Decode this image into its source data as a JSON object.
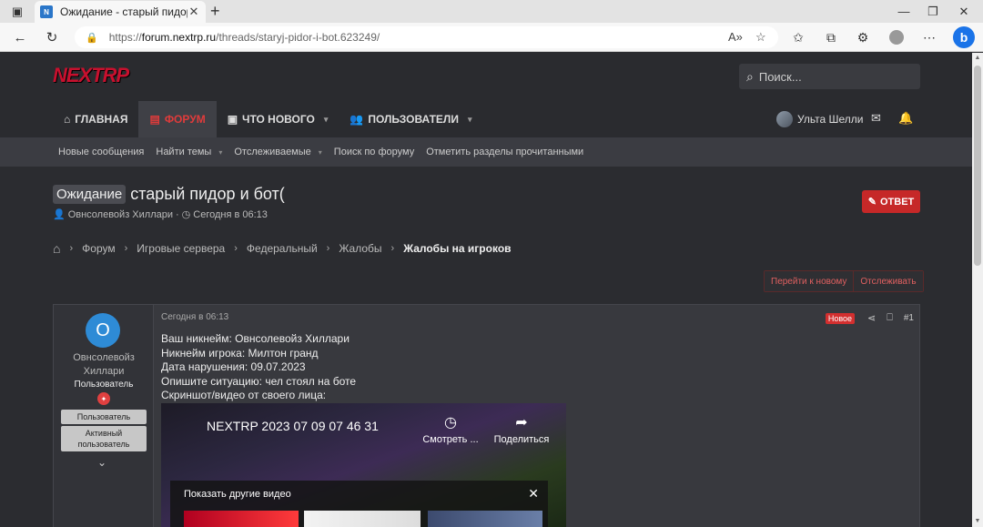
{
  "browser": {
    "tab_title": "Ожидание - старый пидор и бот(",
    "favicon_text": "N",
    "url_proto": "https://",
    "url_host": "forum.nextrp.ru",
    "url_path": "/threads/staryj-pidor-i-bot.623249/"
  },
  "header": {
    "logo": "NEXTRP",
    "search_placeholder": "Поиск...",
    "nav": [
      {
        "label": "Главная",
        "icon": "home-icon",
        "active": false,
        "caret": false
      },
      {
        "label": "Форум",
        "icon": "forum-icon",
        "active": true,
        "caret": false
      },
      {
        "label": "Что нового",
        "icon": "news-icon",
        "active": false,
        "caret": true
      },
      {
        "label": "Пользователи",
        "icon": "users-icon",
        "active": false,
        "caret": true
      }
    ],
    "username": "Ульта Шелли"
  },
  "subnav": [
    {
      "label": "Новые сообщения",
      "caret": false
    },
    {
      "label": "Найти темы",
      "caret": true
    },
    {
      "label": "Отслеживаемые",
      "caret": true
    },
    {
      "label": "Поиск по форуму",
      "caret": false
    },
    {
      "label": "Отметить разделы прочитанными",
      "caret": false
    }
  ],
  "thread": {
    "prefix": "Ожидание",
    "title": "старый пидор и бот(",
    "author": "Овнсолевойз Хиллари",
    "date": "Сегодня в 06:13",
    "reply_label": "ОТВЕТ"
  },
  "breadcrumbs": [
    "Форум",
    "Игровые сервера",
    "Федеральный",
    "Жалобы",
    "Жалобы на игроков"
  ],
  "tools": {
    "goto_new": "Перейти к новому",
    "watch": "Отслеживать"
  },
  "post": {
    "avatar_letter": "O",
    "username": "Овнсолевойз Хиллари",
    "role": "Пользователь",
    "banners": [
      "Пользователь",
      "Активный пользователь"
    ],
    "date": "Сегодня в 06:13",
    "new_badge": "Новое",
    "number": "#1",
    "lines": [
      "Ваш никнейм: Овнсолевойз Хиллари",
      "Никнейм игрока: Милтон гранд",
      "Дата нарушения: 09.07.2023",
      "Опишите ситуацию: чел стоял на боте",
      "Скриншот/видео от своего лица:"
    ],
    "video": {
      "title": "NEXTRP 2023 07 09 07 46 31",
      "watch": "Смотреть ...",
      "share": "Поделиться",
      "more": "Показать другие видео"
    }
  },
  "colors": {
    "accent": "#c62828",
    "background": "#2b2c30",
    "link": "#e03b3b"
  }
}
